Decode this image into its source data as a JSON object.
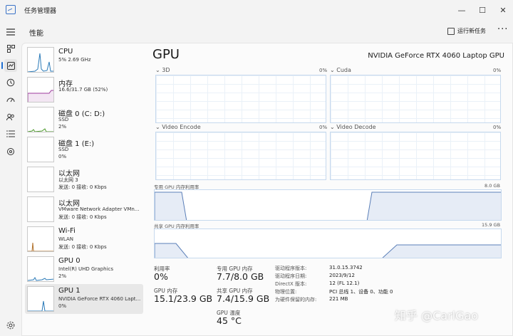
{
  "window": {
    "title": "任务管理器",
    "minimize": "—",
    "maximize": "☐",
    "close": "✕"
  },
  "nav": {
    "icons": [
      "hamburger-icon",
      "processes-icon",
      "performance-icon",
      "history-icon",
      "startup-icon",
      "users-icon",
      "details-icon",
      "services-icon",
      "settings-icon"
    ]
  },
  "header": {
    "title": "性能",
    "run_task": "运行新任务",
    "more": "···"
  },
  "devices": [
    {
      "name": "CPU",
      "line2": "5% 2.69 GHz",
      "line3": ""
    },
    {
      "name": "内存",
      "line2": "16.6/31.7 GB (52%)",
      "line3": ""
    },
    {
      "name": "磁盘 0 (C: D:)",
      "line2": "SSD",
      "line3": "2%"
    },
    {
      "name": "磁盘 1 (E:)",
      "line2": "SSD",
      "line3": "0%"
    },
    {
      "name": "以太网",
      "line2": "以太网 3",
      "line3": "发送: 0 接收: 0 Kbps"
    },
    {
      "name": "以太网",
      "line2": "VMware Network Adapter VMn...",
      "line3": "发送: 0 接收: 0 Kbps"
    },
    {
      "name": "Wi-Fi",
      "line2": "WLAN",
      "line3": "发送: 0 接收: 0 Kbps"
    },
    {
      "name": "GPU 0",
      "line2": "Intel(R) UHD Graphics",
      "line3": "2%"
    },
    {
      "name": "GPU 1",
      "line2": "NVIDIA GeForce RTX 4060 Lapt...",
      "line3": "0%"
    }
  ],
  "gpu": {
    "title": "GPU",
    "model": "NVIDIA GeForce RTX 4060 Laptop GPU",
    "engines": [
      {
        "label": "3D",
        "pct": "0%"
      },
      {
        "label": "Cuda",
        "pct": "0%"
      },
      {
        "label": "Video Encode",
        "pct": "0%"
      },
      {
        "label": "Video Decode",
        "pct": "0%"
      }
    ],
    "dedicated_label": "专用 GPU 内存利用率",
    "dedicated_max": "8.0 GB",
    "shared_label": "共享 GPU 内存利用率",
    "shared_max": "15.9 GB"
  },
  "stats": {
    "utilization_label": "利用率",
    "utilization": "0%",
    "gpu_mem_label": "GPU 内存",
    "gpu_mem": "15.1/23.9 GB",
    "dedicated_label": "专用 GPU 内存",
    "dedicated": "7.7/8.0 GB",
    "shared_label": "共享 GPU 内存",
    "shared": "7.4/15.9 GB",
    "temp_label": "GPU 温度",
    "temp": "45 °C"
  },
  "props": [
    {
      "label": "驱动程序版本:",
      "value": "31.0.15.3742"
    },
    {
      "label": "驱动程序日期:",
      "value": "2023/9/12"
    },
    {
      "label": "DirectX 版本:",
      "value": "12 (FL 12.1)"
    },
    {
      "label": "物理位置:",
      "value": "PCI 总线 1、设备 0、功能 0"
    },
    {
      "label": "为硬件保留的内存:",
      "value": "221 MB"
    }
  ],
  "watermark": "知乎 @CarlGao"
}
